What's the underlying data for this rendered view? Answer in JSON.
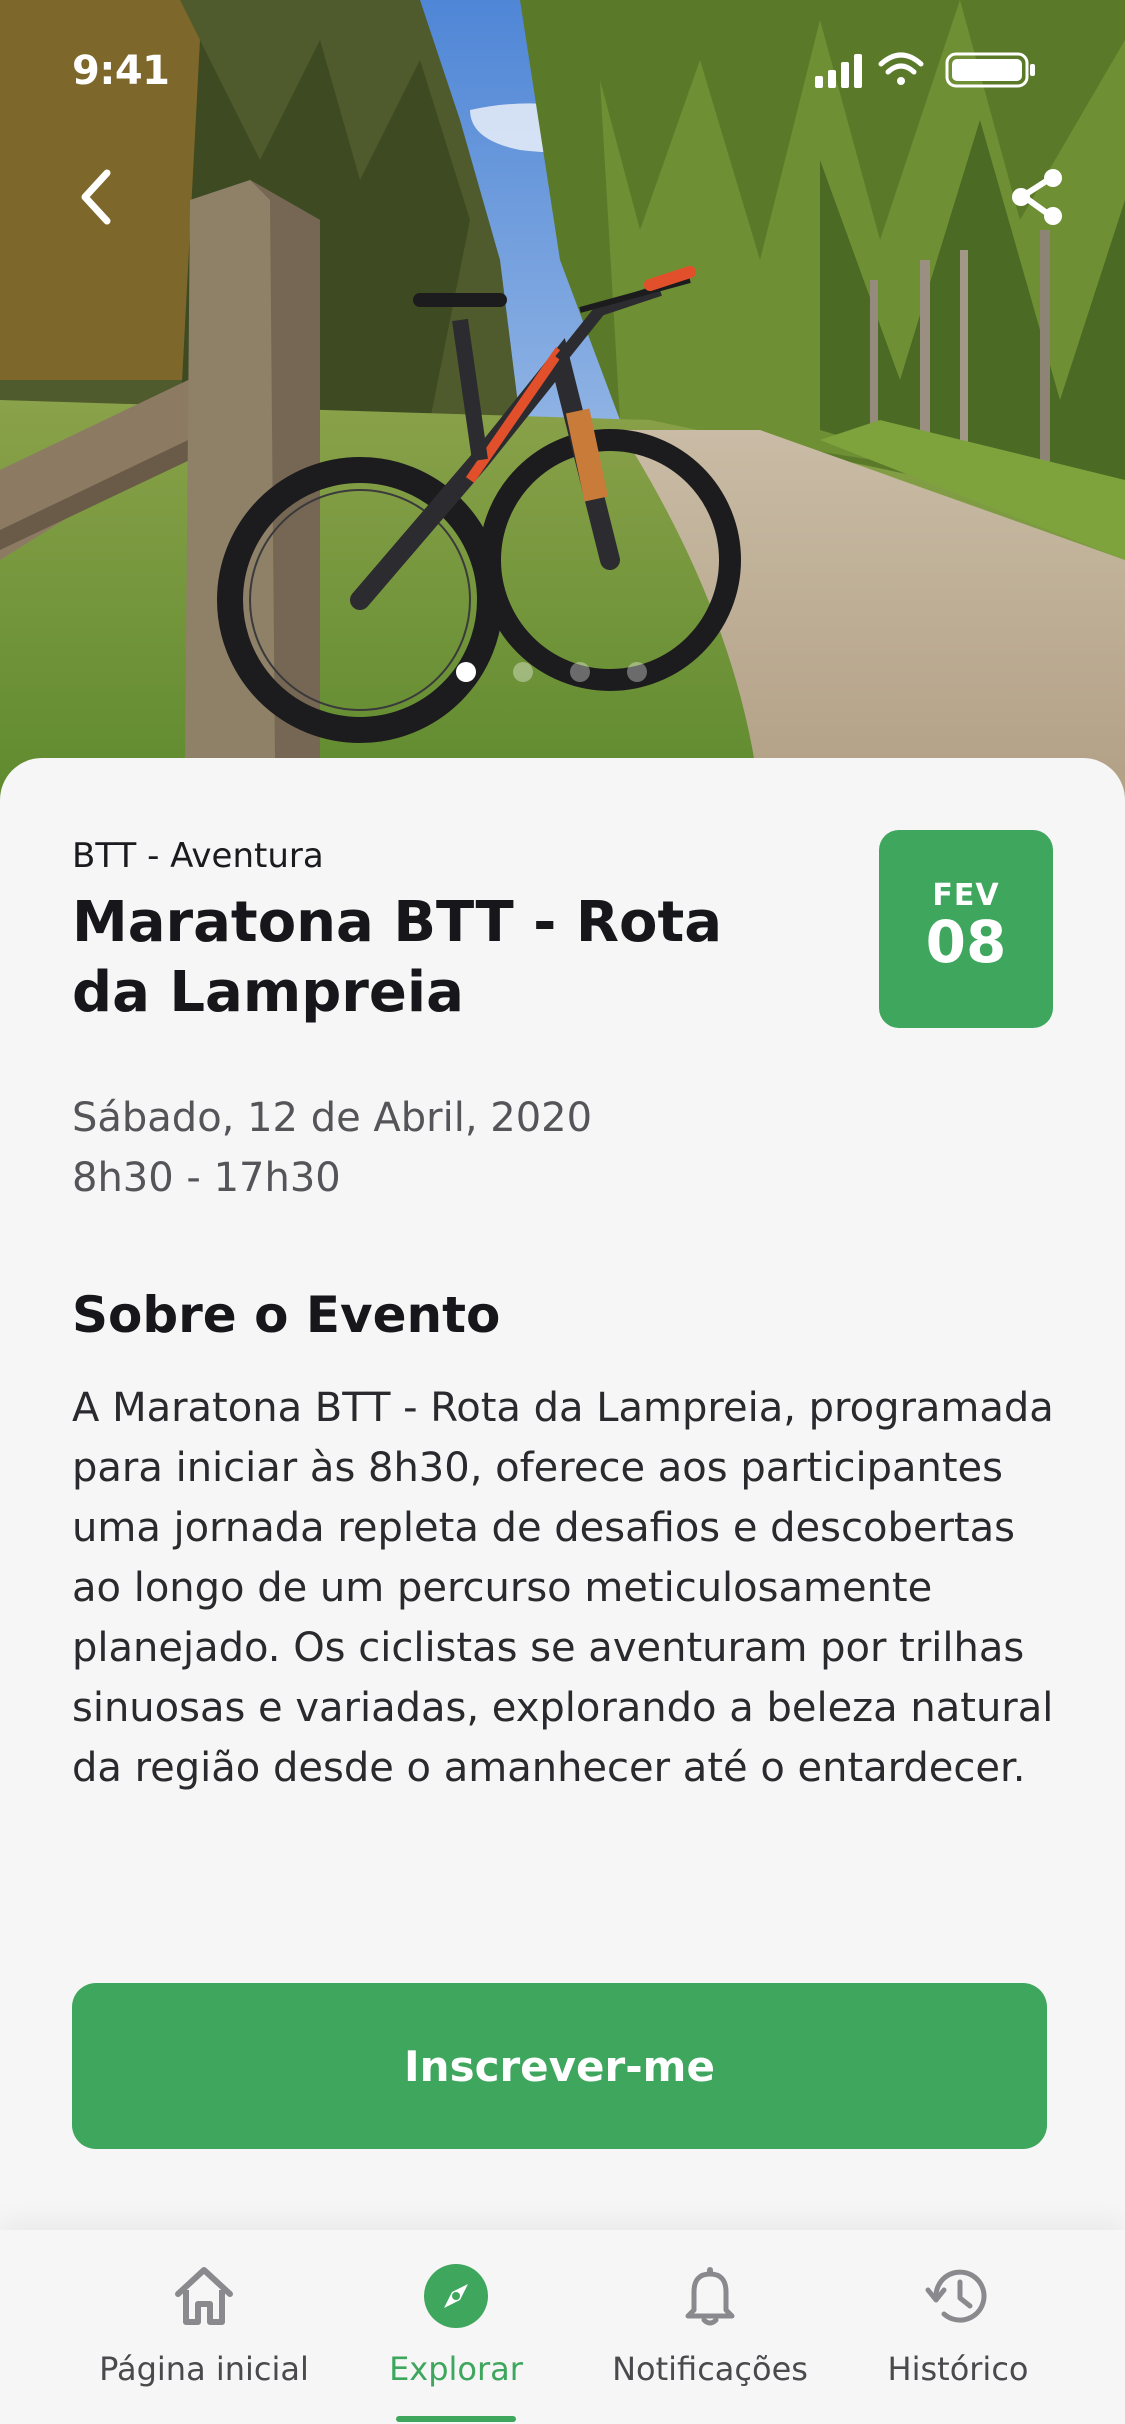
{
  "status_bar": {
    "time": "9:41"
  },
  "hero": {
    "carousel_pages": 4,
    "carousel_active_index": 0
  },
  "event": {
    "category": "BTT - Aventura",
    "title": "Maratona BTT - Rota da Lampreia",
    "date_badge": {
      "month": "FEV",
      "day": "08"
    },
    "date_line": "Sábado, 12 de Abril, 2020",
    "time_line": "8h30 - 17h30",
    "about_heading": "Sobre o Evento",
    "about_text": "A Maratona BTT - Rota da Lampreia, programada para iniciar às 8h30, oferece aos participantes uma jornada repleta de desafios e descobertas ao longo de um percurso meticulosamente planejado. Os ciclistas se aventuram por trilhas sinuosas e variadas, explorando a beleza natural da região desde o amanhecer até o entardecer.",
    "cta_label": "Inscrever-me"
  },
  "bottom_nav": {
    "items": [
      {
        "label": "Página inicial",
        "icon": "home-icon"
      },
      {
        "label": "Explorar",
        "icon": "compass-icon",
        "active": true
      },
      {
        "label": "Notificações",
        "icon": "bell-icon"
      },
      {
        "label": "Histórico",
        "icon": "history-icon"
      }
    ]
  },
  "colors": {
    "accent": "#3ea65d",
    "background": "#f6f6f6",
    "text_primary": "#17171b",
    "text_secondary": "#555559",
    "nav_inactive": "#8a8a8e"
  }
}
